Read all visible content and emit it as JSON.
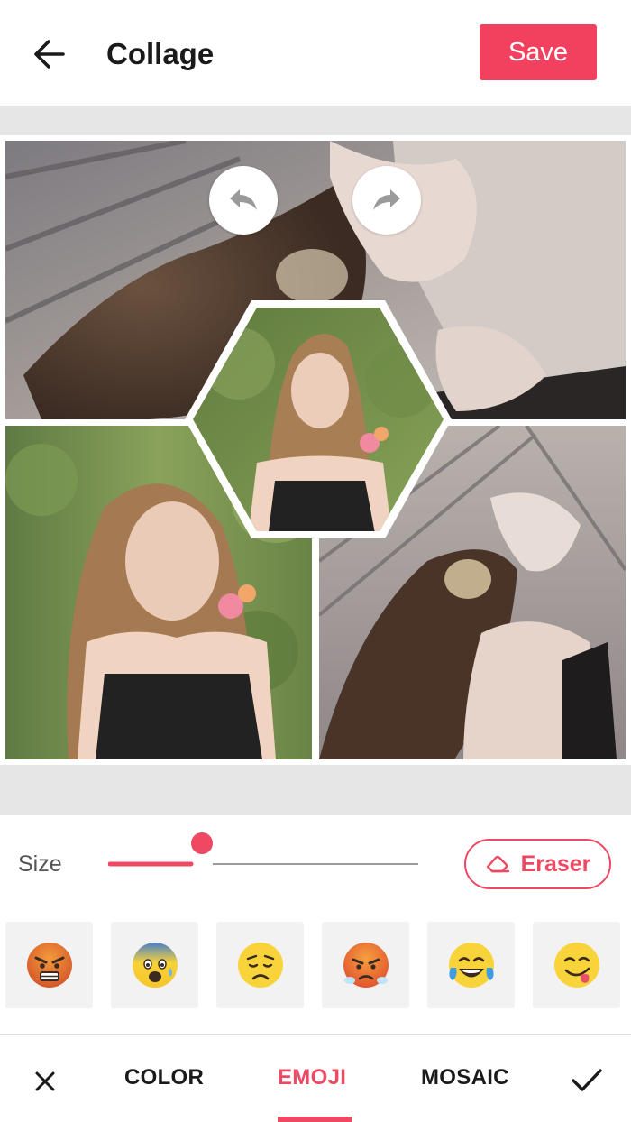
{
  "header": {
    "title": "Collage",
    "save_label": "Save"
  },
  "size_control": {
    "label": "Size",
    "value_fraction": 0.27
  },
  "eraser": {
    "label": "Eraser"
  },
  "emojis": [
    {
      "name": "angry-face",
      "char": "😠"
    },
    {
      "name": "anxious-face-with-sweat",
      "char": "😰"
    },
    {
      "name": "disappointed-face",
      "char": "😞"
    },
    {
      "name": "steaming-angry-face",
      "char": "😤"
    },
    {
      "name": "tears-of-joy-face",
      "char": "😂"
    },
    {
      "name": "tongue-out-face",
      "char": "😋"
    }
  ],
  "tabs": {
    "color": "COLOR",
    "emoji": "EMOJI",
    "mosaic": "MOSAIC",
    "active": "EMOJI"
  },
  "colors": {
    "accent": "#f2415e",
    "band": "#e6e6e6"
  }
}
